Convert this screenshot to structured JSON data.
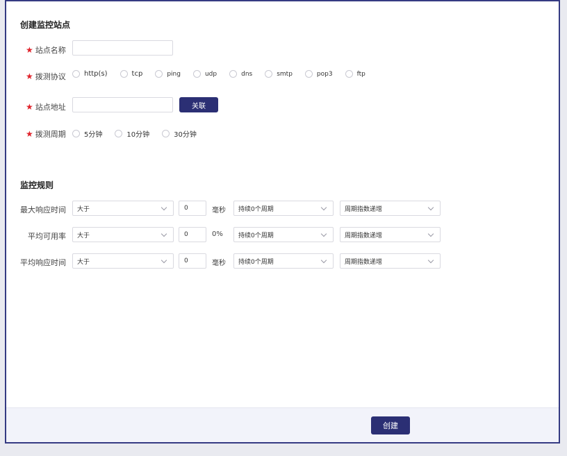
{
  "site_section": {
    "title": "创建监控站点",
    "name_label": "站点名称",
    "protocol_label": "拨测协议",
    "protocols": [
      "http(s)",
      "tcp",
      "ping",
      "udp",
      "dns",
      "smtp",
      "pop3",
      "ftp"
    ],
    "address_label": "站点地址",
    "associate_button": "关联",
    "period_label": "拨测周期",
    "periods": [
      "5分钟",
      "10分钟",
      "30分钟"
    ],
    "name_value": "",
    "address_value": ""
  },
  "rules_section": {
    "title": "监控规则",
    "rules": [
      {
        "label": "最大响应时间",
        "comparator": "大于",
        "value": "0",
        "unit": "毫秒",
        "duration": "持续0个周期",
        "strategy": "周期指数递增"
      },
      {
        "label": "平均可用率",
        "comparator": "大于",
        "value": "0",
        "unit": "0%",
        "duration": "持续0个周期",
        "strategy": "周期指数递增"
      },
      {
        "label": "平均响应时间",
        "comparator": "大于",
        "value": "0",
        "unit": "毫秒",
        "duration": "持续0个周期",
        "strategy": "周期指数递增"
      }
    ]
  },
  "footer": {
    "create_button": "创建"
  },
  "colors": {
    "primary": "#2b2f74",
    "required": "#e0232b",
    "frame_border": "#343a82",
    "footer_bg": "#f2f3fa"
  }
}
